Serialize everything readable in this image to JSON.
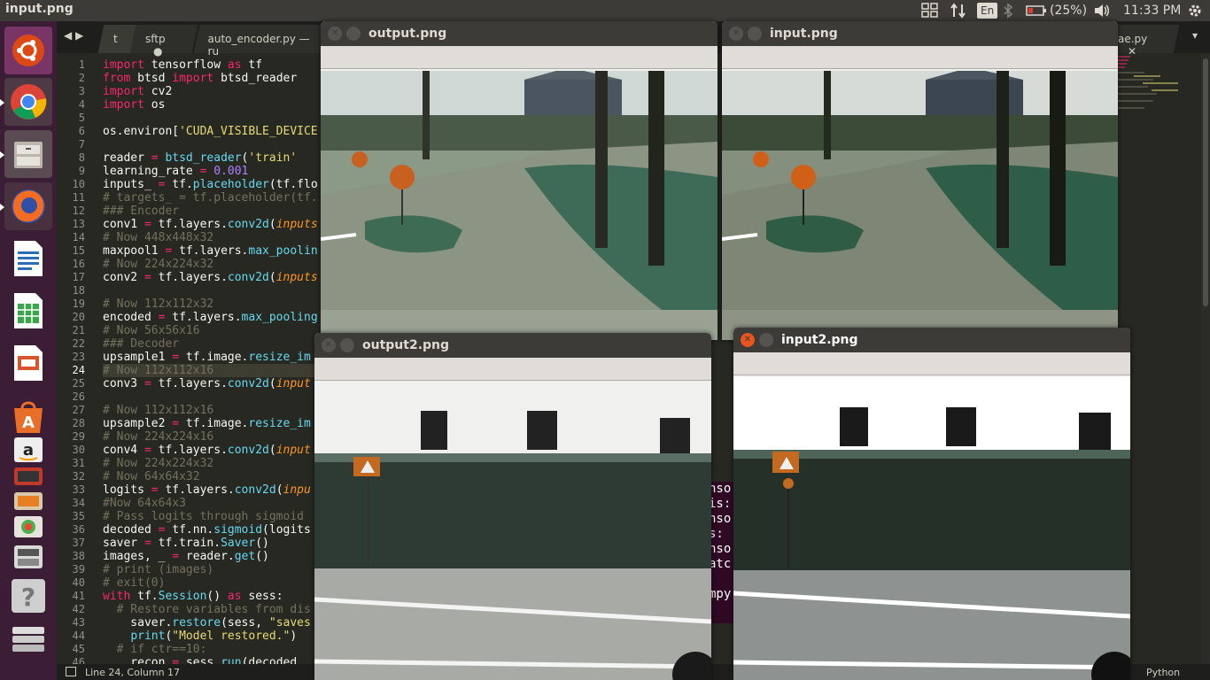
{
  "topbar": {
    "title": "input.png",
    "keyboard": "En",
    "battery": "(25%)",
    "time": "11:33 PM"
  },
  "launcher": {
    "items": [
      "ubuntu-dash",
      "chrome",
      "files",
      "firefox",
      "writer",
      "calc",
      "impress",
      "software-center",
      "amazon",
      "app-8",
      "app-9",
      "app-10",
      "app-11",
      "help",
      "app-13"
    ]
  },
  "editor": {
    "tabs": [
      "t",
      "sftp",
      "auto_encoder.py — ru",
      "ae.py"
    ],
    "status": {
      "position": "Line 24, Column 17",
      "language": "Python"
    },
    "line_numbers": [
      "1",
      "2",
      "3",
      "4",
      "5",
      "6",
      "7",
      "8",
      "9",
      "10",
      "11",
      "12",
      "13",
      "14",
      "15",
      "16",
      "17",
      "18",
      "19",
      "20",
      "21",
      "22",
      "23",
      "24",
      "25",
      "26",
      "27",
      "28",
      "29",
      "30",
      "31",
      "32",
      "33",
      "34",
      "35",
      "36",
      "37",
      "38",
      "39",
      "40",
      "41",
      "42",
      "43",
      "44",
      "45",
      "46"
    ],
    "lines": [
      [
        [
          "kw",
          "import"
        ],
        [
          "",
          " tensorflow "
        ],
        [
          "kw",
          "as"
        ],
        [
          "",
          " tf"
        ]
      ],
      [
        [
          "kw",
          "from"
        ],
        [
          "",
          " btsd "
        ],
        [
          "kw",
          "import"
        ],
        [
          "",
          " btsd_reader"
        ]
      ],
      [
        [
          "kw",
          "import"
        ],
        [
          "",
          " cv2"
        ]
      ],
      [
        [
          "kw",
          "import"
        ],
        [
          "",
          " os"
        ]
      ],
      [],
      [
        [
          "",
          "os.environ["
        ],
        [
          "st",
          "'CUDA_VISIBLE_DEVICE"
        ]
      ],
      [],
      [
        [
          "",
          "reader "
        ],
        [
          "kw",
          "="
        ],
        [
          "",
          " "
        ],
        [
          "fn",
          "btsd_reader"
        ],
        [
          "",
          "("
        ],
        [
          "st",
          "'train'"
        ],
        [
          ", '"
        ]
      ],
      [
        [
          "",
          "learning_rate "
        ],
        [
          "kw",
          "="
        ],
        [
          "",
          " "
        ],
        [
          "nm",
          "0.001"
        ]
      ],
      [
        [
          "",
          "inputs_ "
        ],
        [
          "kw",
          "="
        ],
        [
          "",
          " tf."
        ],
        [
          "fn",
          "placeholder"
        ],
        [
          "",
          "(tf.flo"
        ]
      ],
      [
        [
          "cm",
          "# targets_ = tf.placeholder(tf."
        ]
      ],
      [
        [
          "cm",
          "### Encoder"
        ]
      ],
      [
        [
          "",
          "conv1 "
        ],
        [
          "kw",
          "="
        ],
        [
          "",
          " tf.layers."
        ],
        [
          "fn",
          "conv2d"
        ],
        [
          "",
          "("
        ],
        [
          "pa",
          "inputs"
        ]
      ],
      [
        [
          "cm",
          "# Now 448x448x32"
        ]
      ],
      [
        [
          "",
          "maxpool1 "
        ],
        [
          "kw",
          "="
        ],
        [
          "",
          " tf.layers."
        ],
        [
          "fn",
          "max_poolin"
        ]
      ],
      [
        [
          "cm",
          "# Now 224x224x32"
        ]
      ],
      [
        [
          "",
          "conv2 "
        ],
        [
          "kw",
          "="
        ],
        [
          "",
          " tf.layers."
        ],
        [
          "fn",
          "conv2d"
        ],
        [
          "",
          "("
        ],
        [
          "pa",
          "inputs"
        ]
      ],
      [],
      [
        [
          "cm",
          "# Now 112x112x32"
        ]
      ],
      [
        [
          "",
          "encoded "
        ],
        [
          "kw",
          "="
        ],
        [
          "",
          " tf.layers."
        ],
        [
          "fn",
          "max_pooling"
        ]
      ],
      [
        [
          "cm",
          "# Now 56x56x16"
        ]
      ],
      [
        [
          "cm",
          "### Decoder"
        ]
      ],
      [
        [
          "",
          "upsample1 "
        ],
        [
          "kw",
          "="
        ],
        [
          "",
          " tf.image."
        ],
        [
          "fn",
          "resize_im"
        ]
      ],
      [
        [
          "cm",
          "# Now 112x112x16"
        ]
      ],
      [
        [
          "",
          "conv3 "
        ],
        [
          "kw",
          "="
        ],
        [
          "",
          " tf.layers."
        ],
        [
          "fn",
          "conv2d"
        ],
        [
          "",
          "("
        ],
        [
          "pa",
          "input"
        ]
      ],
      [],
      [
        [
          "cm",
          "# Now 112x112x16"
        ]
      ],
      [
        [
          "",
          "upsample2 "
        ],
        [
          "kw",
          "="
        ],
        [
          "",
          " tf.image."
        ],
        [
          "fn",
          "resize_im"
        ]
      ],
      [
        [
          "cm",
          "# Now 224x224x16"
        ]
      ],
      [
        [
          "",
          "conv4 "
        ],
        [
          "kw",
          "="
        ],
        [
          "",
          " tf.layers."
        ],
        [
          "fn",
          "conv2d"
        ],
        [
          "",
          "("
        ],
        [
          "pa",
          "input"
        ]
      ],
      [
        [
          "cm",
          "# Now 224x224x32"
        ]
      ],
      [
        [
          "cm",
          "# Now 64x64x32"
        ]
      ],
      [
        [
          "",
          "logits "
        ],
        [
          "kw",
          "="
        ],
        [
          "",
          " tf.layers."
        ],
        [
          "fn",
          "conv2d"
        ],
        [
          "",
          "("
        ],
        [
          "pa",
          "inpu"
        ]
      ],
      [
        [
          "cm",
          "#Now 64x64x3"
        ]
      ],
      [
        [
          "cm",
          "# Pass logits through sigmoid"
        ]
      ],
      [
        [
          "",
          "decoded "
        ],
        [
          "kw",
          "="
        ],
        [
          "",
          " tf.nn."
        ],
        [
          "fn",
          "sigmoid"
        ],
        [
          "",
          "(logits"
        ]
      ],
      [
        [
          "",
          "saver "
        ],
        [
          "kw",
          "="
        ],
        [
          "",
          " tf.train."
        ],
        [
          "fn",
          "Saver"
        ],
        [
          "",
          "()"
        ]
      ],
      [
        [
          "",
          "images, _ "
        ],
        [
          "kw",
          "="
        ],
        [
          "",
          " reader."
        ],
        [
          "fn",
          "get"
        ],
        [
          "",
          "()"
        ]
      ],
      [
        [
          "cm",
          "# print (images)"
        ]
      ],
      [
        [
          "cm",
          "# exit(0)"
        ]
      ],
      [
        [
          "kw",
          "with"
        ],
        [
          "",
          " tf."
        ],
        [
          "fn",
          "Session"
        ],
        [
          "",
          "() "
        ],
        [
          "kw",
          "as"
        ],
        [
          "",
          " sess:"
        ]
      ],
      [
        [
          "cm",
          "  # Restore variables from dis"
        ]
      ],
      [
        [
          "",
          "    saver."
        ],
        [
          "fn",
          "restore"
        ],
        [
          "",
          "(sess, "
        ],
        [
          "st",
          "\"saves"
        ]
      ],
      [
        [
          "",
          "    "
        ],
        [
          "fn",
          "print"
        ],
        [
          "",
          "("
        ],
        [
          "st",
          "\"Model restored.\""
        ],
        [
          "",
          ")"
        ]
      ],
      [
        [
          "cm",
          "  # if ctr==10:"
        ]
      ],
      [
        [
          "",
          "    recon "
        ],
        [
          "kw",
          "="
        ],
        [
          "",
          " sess."
        ],
        [
          "fn",
          "run"
        ],
        [
          "",
          "(decoded,"
        ]
      ]
    ],
    "terminal_fragments": [
      "nso",
      "is:",
      "nso",
      "s:",
      "nso",
      "atc",
      "mpy"
    ]
  },
  "windows": {
    "output": {
      "title": "output.png"
    },
    "input": {
      "title": "input.png"
    },
    "output2": {
      "title": "output2.png"
    },
    "input2": {
      "title": "input2.png"
    }
  },
  "colors": {
    "topbar": "#3c3b37",
    "launcher": "#3b1e35",
    "editor_bg": "#272822",
    "keyword": "#f92672",
    "function": "#66d9ef",
    "string": "#e6db74",
    "number": "#ae81ff",
    "comment": "#75715e"
  }
}
